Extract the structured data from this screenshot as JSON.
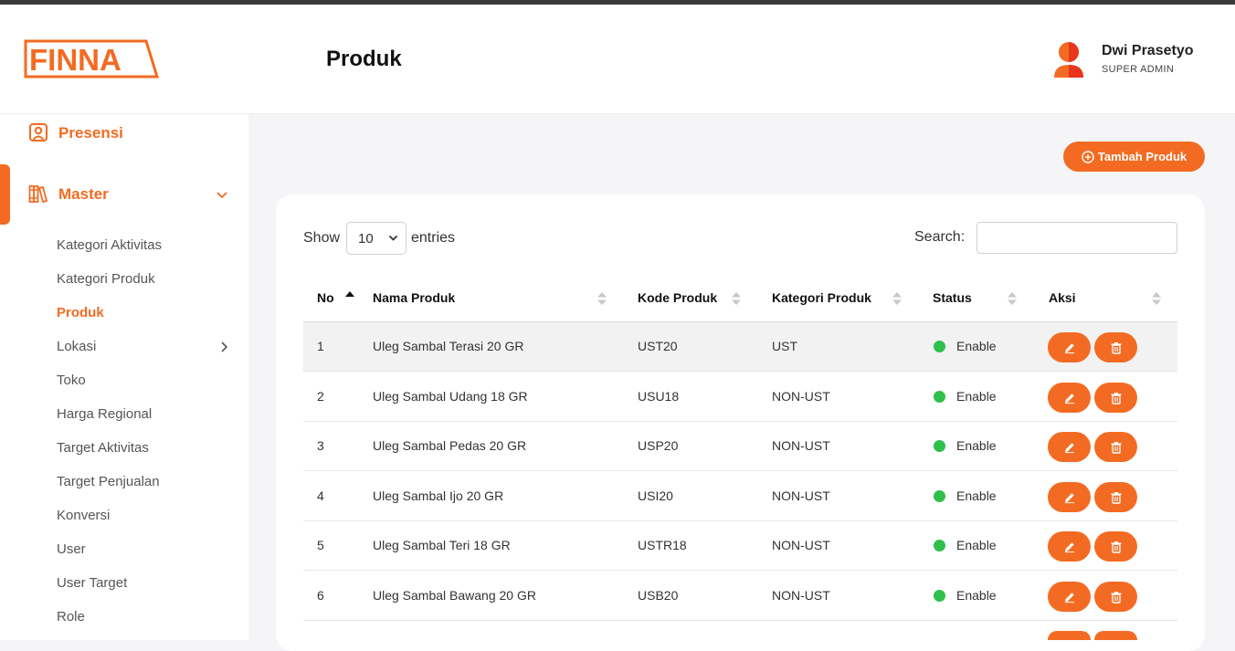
{
  "header": {
    "page_title": "Produk"
  },
  "brand": {
    "logo_text": "FINNA",
    "accent": "#f36b22"
  },
  "user": {
    "name": "Dwi Prasetyo",
    "role": "SUPER ADMIN"
  },
  "sidebar": {
    "presensi": {
      "label": "Presensi",
      "icon": "user-square-icon"
    },
    "master": {
      "label": "Master",
      "icon": "books-icon"
    },
    "sub_items": [
      {
        "label": "Kategori Aktivitas"
      },
      {
        "label": "Kategori Produk"
      },
      {
        "label": "Produk"
      },
      {
        "label": "Lokasi"
      },
      {
        "label": "Toko"
      },
      {
        "label": "Harga Regional"
      },
      {
        "label": "Target Aktivitas"
      },
      {
        "label": "Target Penjualan"
      },
      {
        "label": "Konversi"
      },
      {
        "label": "User"
      },
      {
        "label": "User Target"
      },
      {
        "label": "Role"
      }
    ]
  },
  "toolbar": {
    "add_label": "Tambah Produk"
  },
  "table_controls": {
    "show_label": "Show",
    "entries_value": "10",
    "entries_label": "entries",
    "search_label": "Search:",
    "search_value": ""
  },
  "table": {
    "columns": [
      "No",
      "Nama Produk",
      "Kode Produk",
      "Kategori Produk",
      "Status",
      "Aksi"
    ],
    "rows": [
      {
        "no": "1",
        "nama": "Uleg Sambal Terasi 20 GR",
        "kode": "UST20",
        "kategori": "UST",
        "status": "Enable"
      },
      {
        "no": "2",
        "nama": "Uleg Sambal Udang 18 GR",
        "kode": "USU18",
        "kategori": "NON-UST",
        "status": "Enable"
      },
      {
        "no": "3",
        "nama": "Uleg Sambal Pedas 20 GR",
        "kode": "USP20",
        "kategori": "NON-UST",
        "status": "Enable"
      },
      {
        "no": "4",
        "nama": "Uleg Sambal Ijo 20 GR",
        "kode": "USI20",
        "kategori": "NON-UST",
        "status": "Enable"
      },
      {
        "no": "5",
        "nama": "Uleg Sambal Teri 18 GR",
        "kode": "USTR18",
        "kategori": "NON-UST",
        "status": "Enable"
      },
      {
        "no": "6",
        "nama": "Uleg Sambal Bawang 20 GR",
        "kode": "USB20",
        "kategori": "NON-UST",
        "status": "Enable"
      }
    ]
  }
}
